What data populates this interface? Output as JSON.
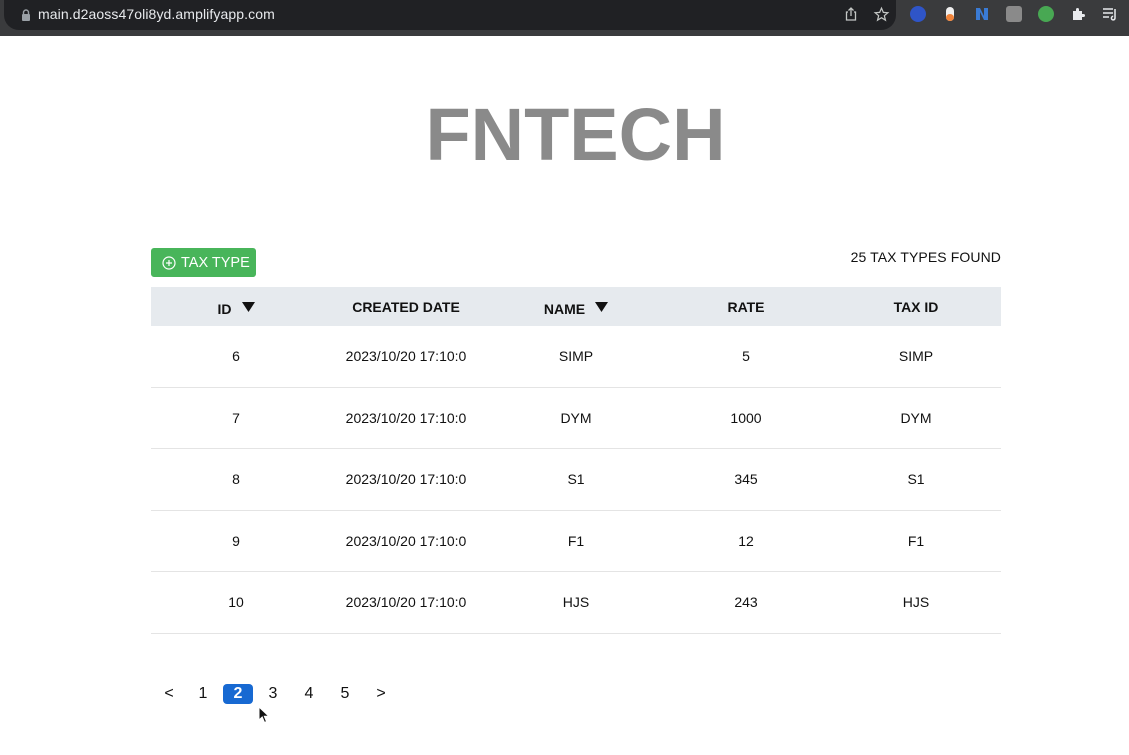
{
  "browser": {
    "url": "main.d2aoss47oli8yd.amplifyapp.com"
  },
  "page": {
    "brand": "FNTECH",
    "add_button_label": "TAX TYPE",
    "count_text": "25 TAX TYPES FOUND"
  },
  "table": {
    "headers": [
      "ID",
      "CREATED DATE",
      "NAME",
      "RATE",
      "TAX ID"
    ],
    "rows": [
      [
        "6",
        "2023/10/20 17:10:0",
        "SIMP",
        "5",
        "SIMP"
      ],
      [
        "7",
        "2023/10/20 17:10:0",
        "DYM",
        "1000",
        "DYM"
      ],
      [
        "8",
        "2023/10/20 17:10:0",
        "S1",
        "345",
        "S1"
      ],
      [
        "9",
        "2023/10/20 17:10:0",
        "F1",
        "12",
        "F1"
      ],
      [
        "10",
        "2023/10/20 17:10:0",
        "HJS",
        "243",
        "HJS"
      ]
    ]
  },
  "pagination": {
    "prev": "<",
    "pages": [
      "1",
      "2",
      "3",
      "4",
      "5"
    ],
    "current": "2",
    "next": ">"
  },
  "colors": {
    "brand_gray": "#8a8a8a",
    "add_button_green": "#48b55a",
    "active_page_blue": "#1769d2",
    "header_bg": "#e6eaee"
  }
}
